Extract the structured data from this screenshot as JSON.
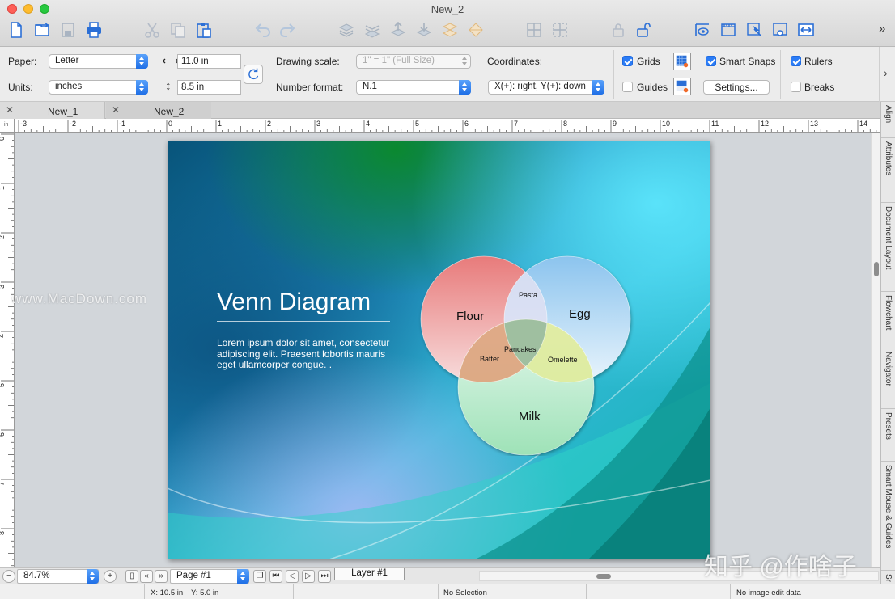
{
  "window": {
    "title": "New_2"
  },
  "propbar": {
    "paper_label": "Paper:",
    "paper_value": "Letter",
    "units_label": "Units:",
    "units_value": "inches",
    "width_value": "11.0 in",
    "height_value": "8.5 in",
    "drawing_scale_label": "Drawing scale:",
    "drawing_scale_value": "1\" = 1\"   (Full Size)",
    "number_format_label": "Number format:",
    "number_format_value": "N.1",
    "coordinates_label": "Coordinates:",
    "coordinates_value": "X(+): right, Y(+): down",
    "grids_label": "Grids",
    "grids_checked": true,
    "guides_label": "Guides",
    "guides_checked": false,
    "smart_snaps_label": "Smart Snaps",
    "smart_snaps_checked": true,
    "settings_label": "Settings...",
    "rulers_label": "Rulers",
    "rulers_checked": true,
    "breaks_label": "Breaks",
    "breaks_checked": false
  },
  "tabs": [
    {
      "label": "New_1",
      "active": false
    },
    {
      "label": "New_2",
      "active": true
    }
  ],
  "ruler": {
    "unit": "in",
    "h_labels": [
      "-3",
      "-2",
      "-1",
      "0",
      "1",
      "2",
      "3",
      "4",
      "5",
      "6",
      "7",
      "8",
      "9",
      "10",
      "11",
      "12",
      "13",
      "14"
    ],
    "v_labels": [
      "0",
      "1",
      "2",
      "3",
      "4",
      "5",
      "6",
      "7",
      "8"
    ]
  },
  "slide": {
    "title": "Venn Diagram",
    "body": "Lorem ipsum dolor sit amet, consectetur adipiscing elit. Praesent lobortis mauris eget ullamcorper congue. .",
    "sets": {
      "a": "Flour",
      "b": "Egg",
      "c": "Milk"
    },
    "intersections": {
      "ab": "Pasta",
      "ac": "Batter",
      "bc": "Omelette",
      "abc": "Pancakes"
    },
    "colors": {
      "a": "#e98a8a",
      "b": "#a8d2f2",
      "c": "#a6e6c0",
      "ac": "#d99a6e",
      "bc": "#dce89a",
      "abc": "#9cbca0"
    }
  },
  "sidebar_tabs": [
    "Align",
    "Attributes",
    "Document Layout",
    "Flowchart",
    "Navigator",
    "Presets",
    "Smart Mouse & Guides",
    "Sr"
  ],
  "navigation": {
    "zoom_value": "84.7%",
    "page_value": "Page #1",
    "layer_label": "Layer #1"
  },
  "status": {
    "x": "X: 10.5 in",
    "y": "Y: 5.0 in",
    "selection": "No Selection",
    "image_edit": "No image edit data"
  },
  "watermarks": {
    "left": "www.MacDown.com",
    "right": "知乎 @作啥子"
  }
}
